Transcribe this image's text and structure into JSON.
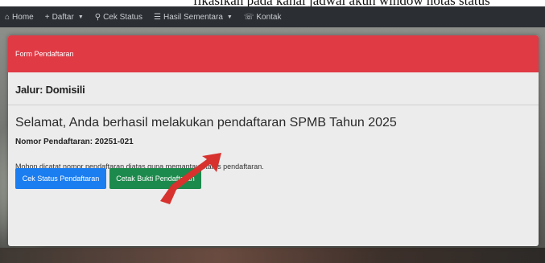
{
  "caption": {
    "text": "fikasikan pada kanal jadwal akun window notas status"
  },
  "nav": {
    "items": [
      {
        "icon": "home-icon",
        "glyph": "⌂",
        "label": "Home",
        "caret": false
      },
      {
        "icon": "plus-icon",
        "glyph": "+",
        "label": "Daftar",
        "caret": true
      },
      {
        "icon": "search-icon",
        "glyph": "⚲",
        "label": "Cek Status",
        "caret": false
      },
      {
        "icon": "list-icon",
        "glyph": "☰",
        "label": "Hasil Sementara",
        "caret": true
      },
      {
        "icon": "phone-icon",
        "glyph": "☏",
        "label": "Kontak",
        "caret": false
      }
    ],
    "caret_glyph": "▼"
  },
  "modal": {
    "title": "Form Pendaftaran",
    "jalur": "Jalur: Domisili",
    "success_message": "Selamat, Anda berhasil melakukan pendaftaran SPMB Tahun 2025",
    "nomor": "Nomor Pendaftaran: 20251-021",
    "note": "Mohon dicatat nomor pendaftaran diatas guna memantau status pendaftaran.",
    "buttons": {
      "cek_status": "Cek Status Pendaftaran",
      "cetak_bukti": "Cetak Bukti Pendaftaran"
    }
  },
  "colors": {
    "header_red": "#e03a45",
    "primary_blue": "#1a7df0",
    "success_green": "#1c8a4c",
    "navbar_dark": "#2b2f33",
    "annotation_arrow": "#d7322e"
  }
}
